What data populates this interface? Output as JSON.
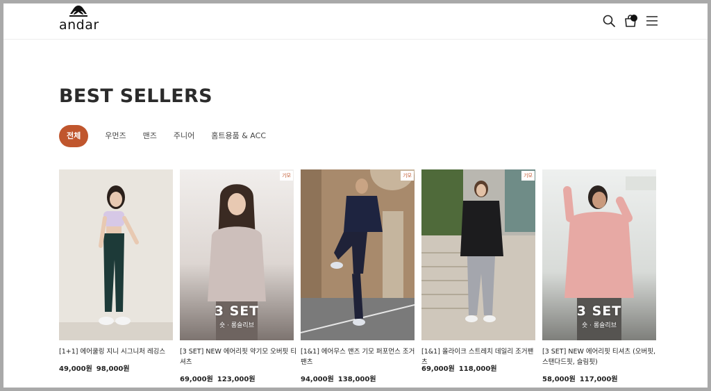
{
  "brand": {
    "name": "andar",
    "logo_icon": "andar-symbol-icon"
  },
  "header": {
    "icons": [
      "search-icon",
      "shopping-bag-icon",
      "hamburger-menu-icon"
    ]
  },
  "page_title": "BEST SELLERS",
  "tabs": [
    {
      "label": "전체",
      "active": true
    },
    {
      "label": "우먼즈",
      "active": false
    },
    {
      "label": "맨즈",
      "active": false
    },
    {
      "label": "주니어",
      "active": false
    },
    {
      "label": "홈트용품 & ACC",
      "active": false
    }
  ],
  "colors": {
    "accent": "#c0562d",
    "text": "#222222",
    "frame": "#a9a9a9"
  },
  "products": [
    {
      "name": "[1+1] 에어쿨링 지니 시그니처 레깅스",
      "sale_price": "49,000원",
      "original_price": "98,000원",
      "badge": "",
      "overlay_title": "",
      "overlay_subtitle": ""
    },
    {
      "name": "[3 SET] NEW 에어리핏 약기모 오버핏 티셔츠",
      "sale_price": "69,000원",
      "original_price": "123,000원",
      "badge": "기모",
      "overlay_title": "3 SET",
      "overlay_subtitle": "숏 · 롱슬리브"
    },
    {
      "name": "[1&1] 에어무스 맨즈 기모 퍼포먼스 조거팬츠",
      "sale_price": "94,000원",
      "original_price": "138,000원",
      "badge": "기모",
      "overlay_title": "",
      "overlay_subtitle": ""
    },
    {
      "name": "[1&1] 올라이크 스트레치 데일리 조거팬츠",
      "sale_price": "69,000원",
      "original_price": "118,000원",
      "badge": "기모",
      "overlay_title": "",
      "overlay_subtitle": ""
    },
    {
      "name": "[3 SET] NEW 에어리핏 티셔츠 (오버핏, 스탠다드핏, 슬림핏)",
      "sale_price": "58,000원",
      "original_price": "117,000원",
      "badge": "",
      "overlay_title": "3 SET",
      "overlay_subtitle": "숏 · 롱슬리브"
    }
  ]
}
